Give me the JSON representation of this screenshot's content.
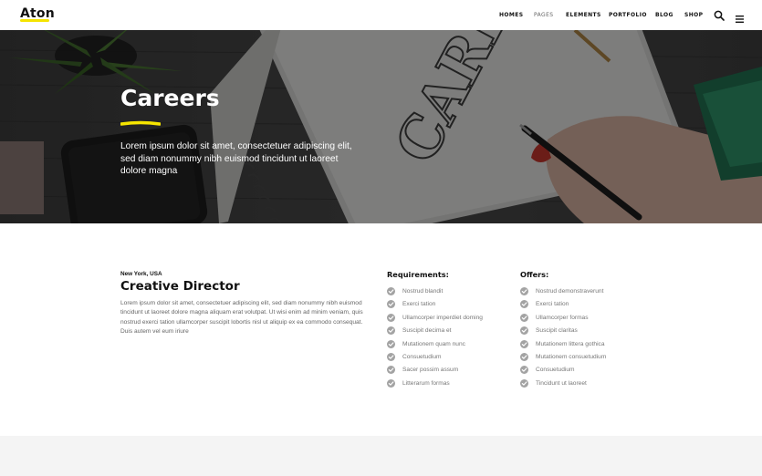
{
  "header": {
    "logo": "Aton",
    "accent_color": "#f5e400",
    "nav": [
      {
        "label": "HOMES",
        "active": false
      },
      {
        "label": "PAGES",
        "active": true
      },
      {
        "label": "ELEMENTS",
        "active": false
      },
      {
        "label": "PORTFOLIO",
        "active": false
      },
      {
        "label": "BLOG",
        "active": false
      },
      {
        "label": "SHOP",
        "active": false
      }
    ],
    "icons": [
      "search-icon",
      "menu-icon"
    ]
  },
  "hero": {
    "title": "Careers",
    "subtitle": "Lorem ipsum dolor sit amet, consectetuer adipiscing elit, sed diam nonummy nibh euismod tincidunt ut laoreet dolore magna",
    "sketch_word": "CAREER"
  },
  "job": {
    "location": "New York, USA",
    "title": "Creative Director",
    "description": "Lorem ipsum dolor sit amet, consectetuer adipiscing elit, sed diam nonummy nibh euismod tincidunt ut laoreet dolore magna aliquam erat volutpat. Ut wisi enim ad minim veniam, quis nostrud exerci tation ullamcorper suscipit lobortis nisl ut aliquip ex ea commodo consequat. Duis autem vel eum iriure"
  },
  "requirements": {
    "heading": "Requirements:",
    "items": [
      "Nostrud blandit",
      "Exerci tation",
      "Ullamcorper imperdiet doming",
      "Suscipit decima et",
      "Mutationem quam nunc",
      "Consuetudium",
      "Sacer possim assum",
      "Litterarum formas"
    ]
  },
  "offers": {
    "heading": "Offers:",
    "items": [
      "Nostrud demonstraverunt",
      "Exerci tation",
      "Ullamcorper formas",
      "Suscipit claritas",
      "Mutationem littera gothica",
      "Mutationem consuetudium",
      "Consuetudium",
      "Tincidunt ut laoreet"
    ]
  }
}
